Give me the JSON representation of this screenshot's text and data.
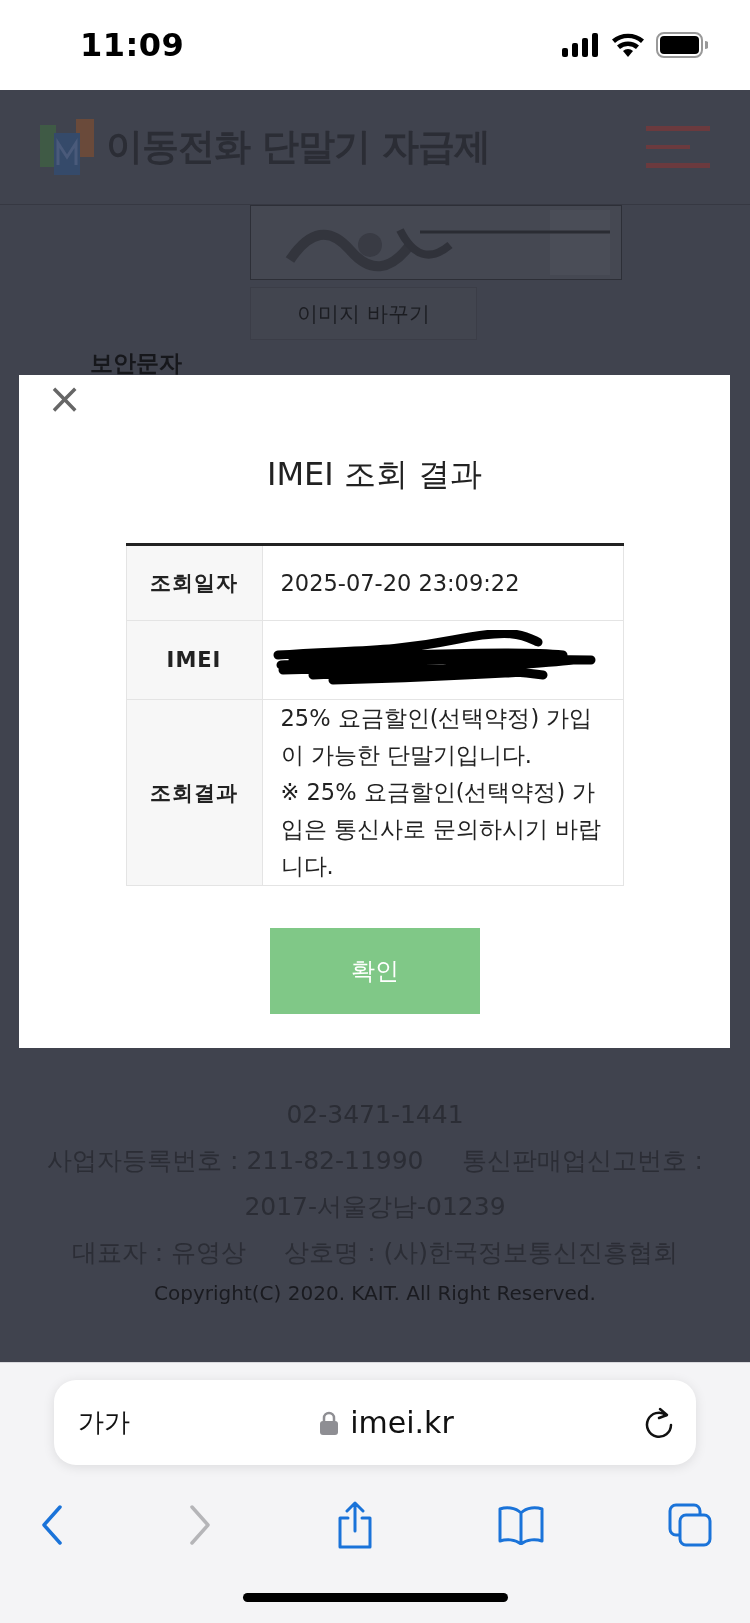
{
  "status_bar": {
    "time": "11:09"
  },
  "site": {
    "title": "이동전화 단말기 자급제",
    "captcha_button": "이미지 바꾸기",
    "captcha_label": "보안문자",
    "footer": [
      [
        "02-3471-1441"
      ],
      [
        "사업자등록번호 : 211-82-11990",
        "통신판매업신고번호 :"
      ],
      [
        "2017-서울강남-01239"
      ],
      [
        "대표자 : 유영상",
        "상호명 : (사)한국정보통신진흥협회"
      ]
    ],
    "copyright": "Copyright(C) 2020. KAIT. All Right Reserved."
  },
  "modal": {
    "close": "×",
    "title": "IMEI 조회 결과",
    "rows": [
      {
        "kind": "text",
        "label": "조회일자",
        "value": [
          "2025-07-20 23:09:22"
        ]
      },
      {
        "kind": "redacted",
        "label": "IMEI"
      },
      {
        "kind": "text",
        "label": "조회결과",
        "value": [
          "25% 요금할인(선택약정) 가입이 가능한 단말기입니다.",
          "※ 25% 요금할인(선택약정) 가입은 통신사로 문의하시기 바랍니다."
        ]
      }
    ],
    "confirm": "확인"
  },
  "browser": {
    "text_size": "가가",
    "url": "imei.kr",
    "back": {
      "disabled": false
    },
    "forward": {
      "disabled": true
    }
  }
}
